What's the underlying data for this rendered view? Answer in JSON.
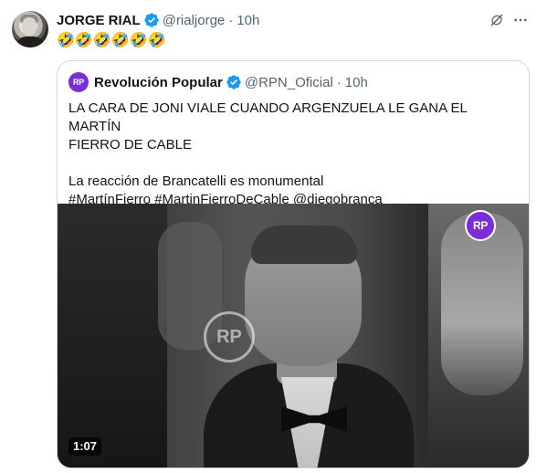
{
  "tweet": {
    "author": {
      "name": "JORGE RIAL",
      "handle": "@rialjorge",
      "separator": "·",
      "time": "10h",
      "verified": true
    },
    "text": "🤣🤣🤣🤣🤣🤣",
    "icons": [
      "grok-icon",
      "more-icon",
      "verified-badge-icon"
    ],
    "quote": {
      "author": {
        "name": "Revolución Popular",
        "handle": "@RPN_Oficial",
        "separator": "·",
        "time": "10h",
        "avatar_text": "RP",
        "verified": true
      },
      "lines": [
        "LA CARA DE JONI VIALE CUANDO ARGENZUELA LE GANA EL MARTÍN",
        "FIERRO DE CABLE",
        "",
        "La reacción de Brancatelli es monumental",
        "#MartínFierro #MartinFierroDeCable @diegobranca"
      ],
      "media": {
        "type": "video",
        "duration": "1:07",
        "watermark_text": "RP",
        "logo_text": "RP"
      }
    }
  },
  "colors": {
    "text_primary": "#0f1419",
    "text_secondary": "#536471",
    "border": "#cfd9de",
    "verified_blue": "#1d9bf0",
    "brand_purple": "#7b2ed6"
  }
}
